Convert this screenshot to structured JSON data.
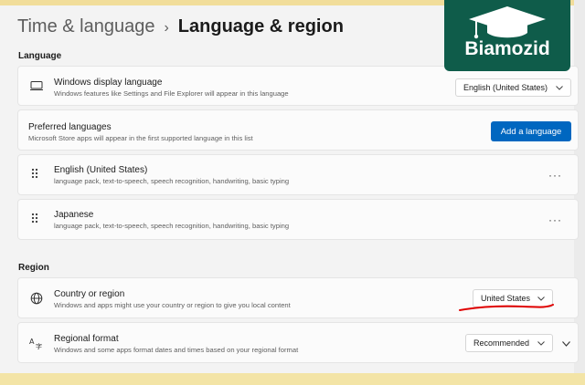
{
  "header": {
    "parent": "Time & language",
    "separator": "›",
    "current": "Language & region"
  },
  "language_section": {
    "label": "Language",
    "display_language": {
      "title": "Windows display language",
      "description": "Windows features like Settings and File Explorer will appear in this language",
      "value": "English (United States)",
      "icon": "monitor-icon"
    },
    "preferred": {
      "title": "Preferred languages",
      "description": "Microsoft Store apps will appear in the first supported language in this list",
      "button": "Add a language"
    },
    "languages": [
      {
        "name": "English (United States)",
        "features": "language pack, text-to-speech, speech recognition, handwriting, basic typing"
      },
      {
        "name": "Japanese",
        "features": "language pack, text-to-speech, speech recognition, handwriting, basic typing"
      }
    ],
    "more_label": "···"
  },
  "region_section": {
    "label": "Region",
    "country": {
      "title": "Country or region",
      "description": "Windows and apps might use your country or region to give you local content",
      "value": "United States",
      "icon": "globe-icon"
    },
    "format": {
      "title": "Regional format",
      "description": "Windows and some apps format dates and times based on your regional format",
      "value": "Recommended",
      "icon": "regional-format-icon"
    }
  },
  "watermark": {
    "text": "Biamozid",
    "icon": "graduation-cap-icon"
  },
  "colors": {
    "accent": "#0067c0",
    "annotation": "#e00000",
    "logo_bg": "#0f5c4a"
  }
}
